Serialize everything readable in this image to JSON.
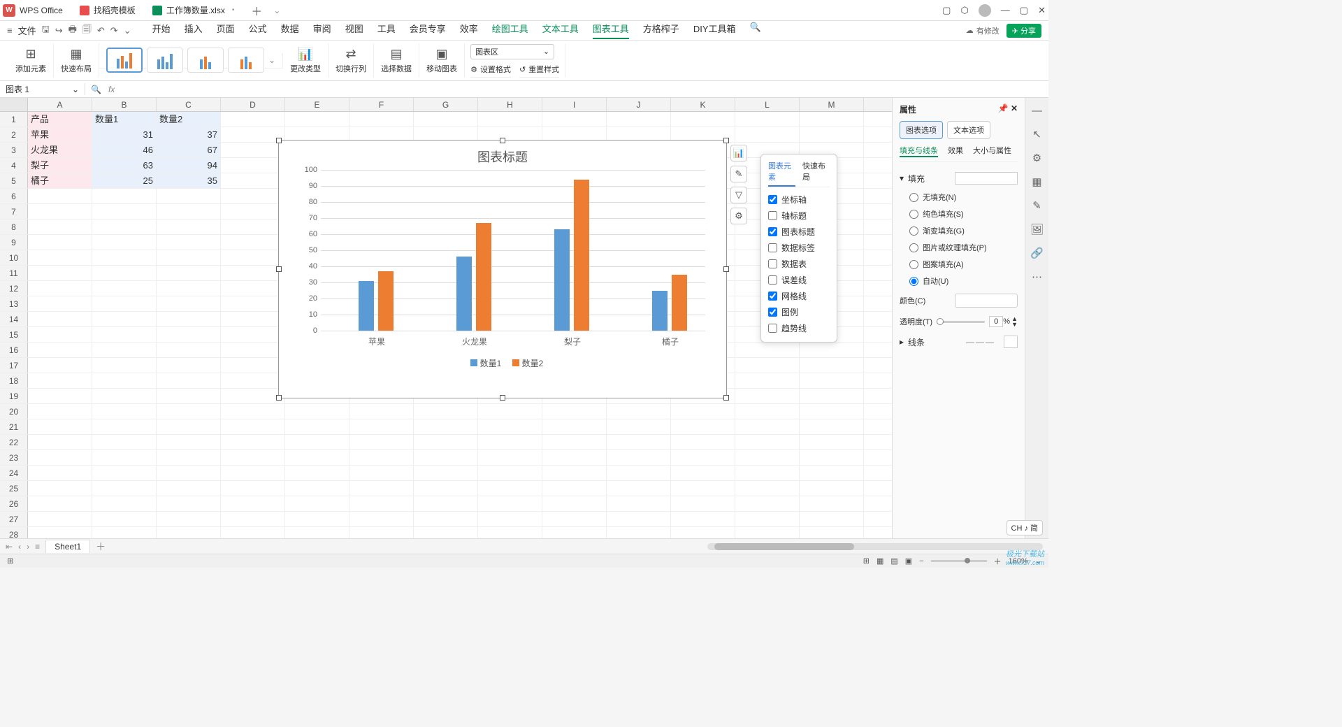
{
  "app": {
    "name": "WPS Office"
  },
  "tabs": {
    "template": "找稻壳模板",
    "doc": "工作簿数量.xlsx"
  },
  "menu": {
    "file": "文件",
    "items": [
      "开始",
      "插入",
      "页面",
      "公式",
      "数据",
      "审阅",
      "视图",
      "工具",
      "会员专享",
      "效率"
    ],
    "tools": [
      "绘图工具",
      "文本工具",
      "图表工具",
      "方格榨子",
      "DIY工具箱"
    ],
    "active_tool": "图表工具",
    "modify": "有修改",
    "share": "分享"
  },
  "ribbon": {
    "add_element": "添加元素",
    "quick_layout": "快速布局",
    "change_type": "更改类型",
    "switch_rc": "切换行列",
    "select_data": "选择数据",
    "move_chart": "移动图表",
    "chart_area": "图表区",
    "set_format": "设置格式",
    "reset_style": "重置样式"
  },
  "namebox": "图表 1",
  "sheet": {
    "cols": [
      "A",
      "B",
      "C",
      "D",
      "E",
      "F",
      "G",
      "H",
      "I",
      "J",
      "K",
      "L",
      "M"
    ],
    "headers": [
      "产品",
      "数量1",
      "数量2"
    ],
    "rows": [
      [
        "苹果",
        "31",
        "37"
      ],
      [
        "火龙果",
        "46",
        "67"
      ],
      [
        "梨子",
        "63",
        "94"
      ],
      [
        "橘子",
        "25",
        "35"
      ]
    ]
  },
  "chart_data": {
    "type": "bar",
    "title": "图表标题",
    "categories": [
      "苹果",
      "火龙果",
      "梨子",
      "橘子"
    ],
    "series": [
      {
        "name": "数量1",
        "values": [
          31,
          46,
          63,
          25
        ],
        "color": "#5b9bd5"
      },
      {
        "name": "数量2",
        "values": [
          37,
          67,
          94,
          35
        ],
        "color": "#ed7d31"
      }
    ],
    "ylim": [
      0,
      100
    ],
    "yticks": [
      0,
      10,
      20,
      30,
      40,
      50,
      60,
      70,
      80,
      90,
      100
    ],
    "xlabel": "",
    "ylabel": "",
    "legend_position": "bottom",
    "grid": true
  },
  "chart_popup": {
    "tabs": [
      "图表元素",
      "快速布局"
    ],
    "active_tab": "图表元素",
    "options": [
      {
        "label": "坐标轴",
        "checked": true
      },
      {
        "label": "轴标题",
        "checked": false
      },
      {
        "label": "图表标题",
        "checked": true
      },
      {
        "label": "数据标签",
        "checked": false
      },
      {
        "label": "数据表",
        "checked": false
      },
      {
        "label": "误差线",
        "checked": false
      },
      {
        "label": "网格线",
        "checked": true
      },
      {
        "label": "图例",
        "checked": true
      },
      {
        "label": "趋势线",
        "checked": false
      }
    ]
  },
  "props": {
    "title": "属性",
    "seg": [
      "图表选项",
      "文本选项"
    ],
    "subtabs": [
      "填充与线条",
      "效果",
      "大小与属性"
    ],
    "fill_header": "填充",
    "fill_options": [
      "无填充(N)",
      "纯色填充(S)",
      "渐变填充(G)",
      "图片或纹理填充(P)",
      "图案填充(A)",
      "自动(U)"
    ],
    "fill_selected": "自动(U)",
    "color_label": "颜色(C)",
    "opacity_label": "透明度(T)",
    "opacity_value": "0",
    "opacity_unit": "%",
    "line_header": "线条"
  },
  "sheet_tab": "Sheet1",
  "status": {
    "zoom": "160%",
    "ime": "CH ♪ 简"
  },
  "watermark": {
    "main": "极光下载站",
    "sub": "www.xz7.com"
  }
}
